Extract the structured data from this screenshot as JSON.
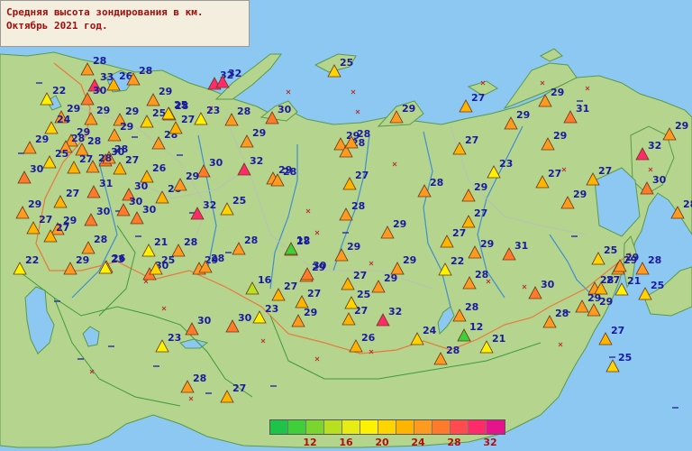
{
  "title": {
    "line1": "Средняя высота зондирования в км.",
    "line2": "Октябрь 2021 год."
  },
  "legend": {
    "colors": [
      "#1ec44a",
      "#3fcf3a",
      "#7ad62e",
      "#b8e020",
      "#e6ec14",
      "#fff200",
      "#ffd400",
      "#ffb400",
      "#ff9a20",
      "#ff7a2a",
      "#ff4a50",
      "#ff2a6a",
      "#e6148c"
    ],
    "tick_labels": [
      "12",
      "16",
      "20",
      "24",
      "28",
      "32"
    ]
  },
  "stations": [
    {
      "v": "28",
      "c": "#ff9a20"
    },
    {
      "v": "33",
      "c": "#ff2a6a"
    },
    {
      "v": "26",
      "c": "#ffb400"
    },
    {
      "v": "28",
      "c": "#ff9a20"
    },
    {
      "v": "32",
      "c": "#ff2a6a"
    },
    {
      "v": "32",
      "c": "#ff2a6a"
    },
    {
      "v": "22",
      "c": "#fff200"
    },
    {
      "v": "30",
      "c": "#ff7a2a"
    },
    {
      "v": "29",
      "c": "#ff9a20"
    },
    {
      "v": "29",
      "c": "#ff9a20"
    },
    {
      "v": "29",
      "c": "#ff9a20"
    },
    {
      "v": "25",
      "c": "#ffd400"
    },
    {
      "v": "29",
      "c": "#ff9a20"
    },
    {
      "v": "28",
      "c": "#ff9a20"
    },
    {
      "v": "23",
      "c": "#fff200"
    },
    {
      "v": "28",
      "c": "#ff9a20"
    },
    {
      "v": "25",
      "c": "#ffd400"
    },
    {
      "v": "24",
      "c": "#ffd400"
    },
    {
      "v": "29",
      "c": "#ff9a20"
    },
    {
      "v": "28",
      "c": "#ff9a20"
    },
    {
      "v": "29",
      "c": "#ff9a20"
    },
    {
      "v": "30",
      "c": "#ff7a2a"
    },
    {
      "v": "28",
      "c": "#ff9a20"
    },
    {
      "v": "27",
      "c": "#ffb400"
    },
    {
      "v": "28",
      "c": "#ff9a20"
    },
    {
      "v": "29",
      "c": "#ff9a20"
    },
    {
      "v": "28",
      "c": "#ff9a20"
    },
    {
      "v": "27",
      "c": "#ffb400"
    },
    {
      "v": "25",
      "c": "#ffd400"
    },
    {
      "v": "27",
      "c": "#ffb400"
    },
    {
      "v": "28",
      "c": "#ff9a20"
    },
    {
      "v": "30",
      "c": "#ff7a2a"
    },
    {
      "v": "26",
      "c": "#ffb400"
    },
    {
      "v": "30",
      "c": "#ff7a2a"
    },
    {
      "v": "32",
      "c": "#ff2a6a"
    },
    {
      "v": "29",
      "c": "#ff9a20"
    },
    {
      "v": "31",
      "c": "#ff7a2a"
    },
    {
      "v": "30",
      "c": "#ff7a2a"
    },
    {
      "v": "26",
      "c": "#ffb400"
    },
    {
      "v": "29",
      "c": "#ff9a20"
    },
    {
      "v": "27",
      "c": "#ffb400"
    },
    {
      "v": "30",
      "c": "#ff7a2a"
    },
    {
      "v": "30",
      "c": "#ff7a2a"
    },
    {
      "v": "30",
      "c": "#ff7a2a"
    },
    {
      "v": "32",
      "c": "#ff2a6a"
    },
    {
      "v": "25",
      "c": "#ffd400"
    },
    {
      "v": "29",
      "c": "#ff9a20"
    },
    {
      "v": "27",
      "c": "#ffb400"
    },
    {
      "v": "29",
      "c": "#ff9a20"
    },
    {
      "v": "27",
      "c": "#ffb400"
    },
    {
      "v": "28",
      "c": "#ff9a20"
    },
    {
      "v": "22",
      "c": "#fff200"
    },
    {
      "v": "26",
      "c": "#ffb400"
    },
    {
      "v": "30",
      "c": "#ff7a2a"
    },
    {
      "v": "29",
      "c": "#ff9a20"
    },
    {
      "v": "28",
      "c": "#ff9a20"
    },
    {
      "v": "29",
      "c": "#ff9a20"
    },
    {
      "v": "28",
      "c": "#ff9a20"
    },
    {
      "v": "21",
      "c": "#fff200"
    },
    {
      "v": "28",
      "c": "#ff9a20"
    },
    {
      "v": "23",
      "c": "#fff200"
    },
    {
      "v": "25",
      "c": "#ffd400"
    },
    {
      "v": "28",
      "c": "#ff9a20"
    },
    {
      "v": "12",
      "c": "#3fcf3a"
    },
    {
      "v": "29",
      "c": "#ff9a20"
    },
    {
      "v": "30",
      "c": "#ff7a2a"
    },
    {
      "v": "16",
      "c": "#b8e020"
    },
    {
      "v": "27",
      "c": "#ffb400"
    },
    {
      "v": "27",
      "c": "#ffb400"
    },
    {
      "v": "29",
      "c": "#ff9a20"
    },
    {
      "v": "27",
      "c": "#ffb400"
    },
    {
      "v": "25",
      "c": "#ffd400"
    },
    {
      "v": "29",
      "c": "#ff9a20"
    },
    {
      "v": "29",
      "c": "#ff9a20"
    },
    {
      "v": "27",
      "c": "#ffb400"
    },
    {
      "v": "23",
      "c": "#fff200"
    },
    {
      "v": "30",
      "c": "#ff7a2a"
    },
    {
      "v": "30",
      "c": "#ff7a2a"
    },
    {
      "v": "23",
      "c": "#fff200"
    },
    {
      "v": "28",
      "c": "#ff9a20"
    },
    {
      "v": "27",
      "c": "#ffb400"
    },
    {
      "v": "26",
      "c": "#ffb400"
    },
    {
      "v": "32",
      "c": "#ff2a6a"
    },
    {
      "v": "24",
      "c": "#ffd400"
    },
    {
      "v": "28",
      "c": "#ff9a20"
    },
    {
      "v": "28",
      "c": "#ff9a20"
    },
    {
      "v": "12",
      "c": "#3fcf3a"
    },
    {
      "v": "21",
      "c": "#fff200"
    },
    {
      "v": "29",
      "c": "#ff9a20"
    },
    {
      "v": "22",
      "c": "#fff200"
    },
    {
      "v": "29",
      "c": "#ff9a20"
    },
    {
      "v": "28",
      "c": "#ff9a20"
    },
    {
      "v": "28",
      "c": "#ff9a20"
    },
    {
      "v": "29",
      "c": "#ff9a20"
    },
    {
      "v": "31",
      "c": "#ff7a2a"
    },
    {
      "v": "30",
      "c": "#ff7a2a"
    },
    {
      "v": "28",
      "c": "#ff9a20"
    },
    {
      "v": "29",
      "c": "#ff9a20"
    },
    {
      "v": "27",
      "c": "#ffb400"
    },
    {
      "v": "27",
      "c": "#ffb400"
    },
    {
      "v": "29",
      "c": "#ff9a20"
    },
    {
      "v": "28",
      "c": "#ff9a20"
    },
    {
      "v": "27",
      "c": "#ffb400"
    },
    {
      "v": "28",
      "c": "#ff9a20"
    },
    {
      "v": "23",
      "c": "#fff200"
    },
    {
      "v": "29",
      "c": "#ff9a20"
    },
    {
      "v": "27",
      "c": "#ffb400"
    },
    {
      "v": "27",
      "c": "#ffb400"
    },
    {
      "v": "29",
      "c": "#ff9a20"
    },
    {
      "v": "28",
      "c": "#ff9a20"
    },
    {
      "v": "30",
      "c": "#ff7a2a"
    },
    {
      "v": "29",
      "c": "#ff9a20"
    },
    {
      "v": "25",
      "c": "#ffd400"
    },
    {
      "v": "29",
      "c": "#ff9a20"
    },
    {
      "v": "31",
      "c": "#ff7a2a"
    },
    {
      "v": "27",
      "c": "#ffb400"
    },
    {
      "v": "29",
      "c": "#ff9a20"
    },
    {
      "v": "32",
      "c": "#ff2a6a"
    },
    {
      "v": "29",
      "c": "#ff9a20"
    },
    {
      "v": "27",
      "c": "#ffb400"
    },
    {
      "v": "25",
      "c": "#ffd400"
    },
    {
      "v": "29",
      "c": "#ff9a20"
    },
    {
      "v": "30",
      "c": "#ff7a2a"
    },
    {
      "v": "28",
      "c": "#ff9a20"
    },
    {
      "v": "28",
      "c": "#ff9a20"
    },
    {
      "v": "29",
      "c": "#ff9a20"
    },
    {
      "v": "29",
      "c": "#ff9a20"
    },
    {
      "v": "27",
      "c": "#ffb400"
    },
    {
      "v": "21",
      "c": "#fff200"
    },
    {
      "v": "25",
      "c": "#ffd400"
    },
    {
      "v": "29",
      "c": "#ff9a20"
    },
    {
      "v": "28",
      "c": "#ff9a20"
    },
    {
      "v": "27",
      "c": "#ffb400"
    },
    {
      "v": "25",
      "c": "#ffd400"
    },
    {
      "v": "29",
      "c": "#ff9a20"
    },
    {
      "v": "28",
      "c": "#ff9a20"
    },
    {
      "v": "30",
      "c": "#ff7a2a"
    },
    {
      "v": "29",
      "c": "#ff9a20"
    },
    {
      "v": "27",
      "c": "#ffb400"
    },
    {
      "v": "28",
      "c": "#ff9a20"
    },
    {
      "v": "28",
      "c": "#ff9a20"
    },
    {
      "v": "29",
      "c": "#ff9a20"
    }
  ]
}
